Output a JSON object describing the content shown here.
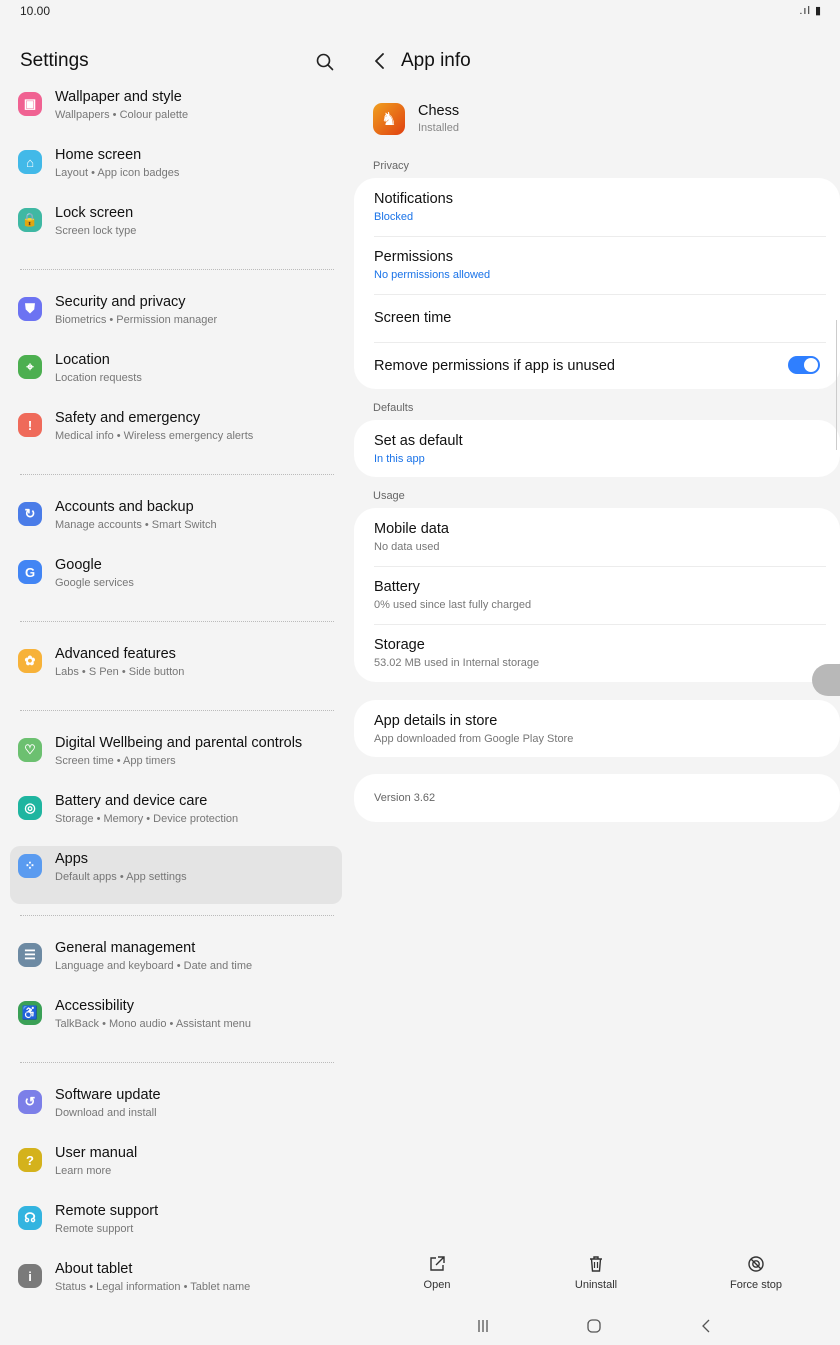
{
  "status_bar": {
    "time": "10.00",
    "system": ".ıl ▮"
  },
  "left": {
    "title": "Settings",
    "items": [
      {
        "title": "Wallpaper and style",
        "sub": "Wallpapers  •  Colour palette",
        "color": "#f06292",
        "glyph": "▣",
        "group": 0
      },
      {
        "title": "Home screen",
        "sub": "Layout  •  App icon badges",
        "color": "#42b9e8",
        "glyph": "⌂",
        "group": 0
      },
      {
        "title": "Lock screen",
        "sub": "Screen lock type",
        "color": "#3fb8a3",
        "glyph": "🔒",
        "group": 0
      },
      {
        "title": "Security and privacy",
        "sub": "Biometrics  •  Permission manager",
        "color": "#6c73f2",
        "glyph": "⛊",
        "group": 1
      },
      {
        "title": "Location",
        "sub": "Location requests",
        "color": "#4caf50",
        "glyph": "⌖",
        "group": 1
      },
      {
        "title": "Safety and emergency",
        "sub": "Medical info  •  Wireless emergency alerts",
        "color": "#ef6a5a",
        "glyph": "!",
        "group": 1
      },
      {
        "title": "Accounts and backup",
        "sub": "Manage accounts  •  Smart Switch",
        "color": "#4a7ce8",
        "glyph": "↻",
        "group": 2
      },
      {
        "title": "Google",
        "sub": "Google services",
        "color": "#4285f4",
        "glyph": "G",
        "group": 2
      },
      {
        "title": "Advanced features",
        "sub": "Labs  •  S Pen  •  Side button",
        "color": "#f7b239",
        "glyph": "✿",
        "group": 3
      },
      {
        "title": "Digital Wellbeing and parental controls",
        "sub": "Screen time  •  App timers",
        "color": "#6cc070",
        "glyph": "♡",
        "group": 4
      },
      {
        "title": "Battery and device care",
        "sub": "Storage  •  Memory  •  Device protection",
        "color": "#1fb5a0",
        "glyph": "◎",
        "group": 4
      },
      {
        "title": "Apps",
        "sub": "Default apps  •  App settings",
        "color": "#5a9bf0",
        "glyph": "⁘",
        "group": 4,
        "active": true
      },
      {
        "title": "General management",
        "sub": "Language and keyboard  •  Date and time",
        "color": "#6d8aa3",
        "glyph": "☰",
        "group": 5
      },
      {
        "title": "Accessibility",
        "sub": "TalkBack  •  Mono audio  •  Assistant menu",
        "color": "#3aa056",
        "glyph": "♿",
        "group": 5
      },
      {
        "title": "Software update",
        "sub": "Download and install",
        "color": "#7c7fe8",
        "glyph": "↺",
        "group": 6
      },
      {
        "title": "User manual",
        "sub": "Learn more",
        "color": "#d4b21c",
        "glyph": "?",
        "group": 6
      },
      {
        "title": "Remote support",
        "sub": "Remote support",
        "color": "#33b4e0",
        "glyph": "☊",
        "group": 6
      },
      {
        "title": "About tablet",
        "sub": "Status  •  Legal information  •  Tablet name",
        "color": "#7a7a7a",
        "glyph": "i",
        "group": 6
      }
    ]
  },
  "right": {
    "title": "App info",
    "app": {
      "name": "Chess",
      "status": "Installed"
    },
    "privacy_label": "Privacy",
    "notifications": {
      "title": "Notifications",
      "sub": "Blocked"
    },
    "permissions": {
      "title": "Permissions",
      "sub": "No permissions allowed"
    },
    "screen_time": {
      "title": "Screen time"
    },
    "remove_permissions": {
      "title": "Remove permissions if app is unused",
      "enabled": true
    },
    "defaults_label": "Defaults",
    "set_default": {
      "title": "Set as default",
      "sub": "In this app"
    },
    "usage_label": "Usage",
    "mobile_data": {
      "title": "Mobile data",
      "sub": "No data used"
    },
    "battery": {
      "title": "Battery",
      "sub": "0% used since last fully charged"
    },
    "storage": {
      "title": "Storage",
      "sub": "53.02 MB used in Internal storage"
    },
    "store": {
      "title": "App details in store",
      "sub": "App downloaded from Google Play Store"
    },
    "version": "Version 3.62"
  },
  "actions": {
    "open": "Open",
    "uninstall": "Uninstall",
    "force_stop": "Force stop"
  }
}
